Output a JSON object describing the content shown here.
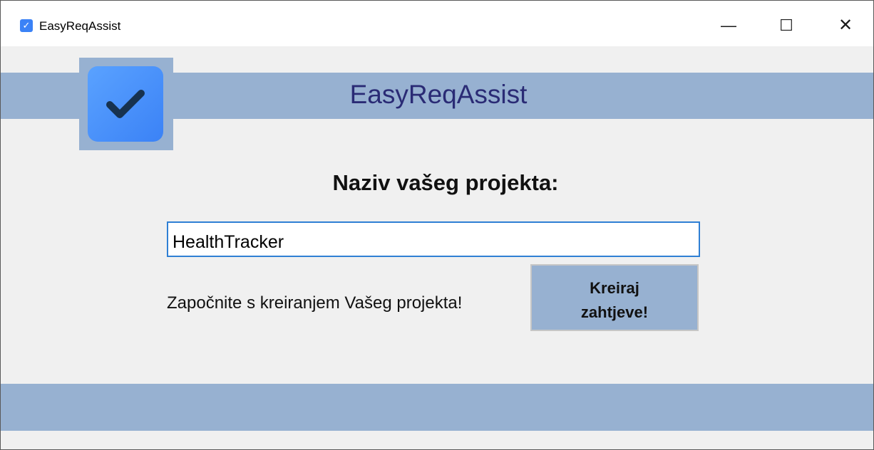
{
  "window": {
    "title": "EasyReqAssist",
    "minimize_glyph": "—",
    "maximize_glyph": "☐",
    "close_glyph": "✕"
  },
  "header": {
    "app_title": "EasyReqAssist",
    "logo_icon": "checkmark-icon"
  },
  "form": {
    "project_label": "Naziv vašeg projekta:",
    "project_value": "HealthTracker",
    "start_text": "Započnite s kreiranjem Vašeg projekta!",
    "create_button_label": "Kreiraj zahtjeve!"
  },
  "colors": {
    "band": "#97b1d1",
    "title": "#2a2b75",
    "logo": "#3b82f6",
    "input_border": "#2f7fd4"
  }
}
